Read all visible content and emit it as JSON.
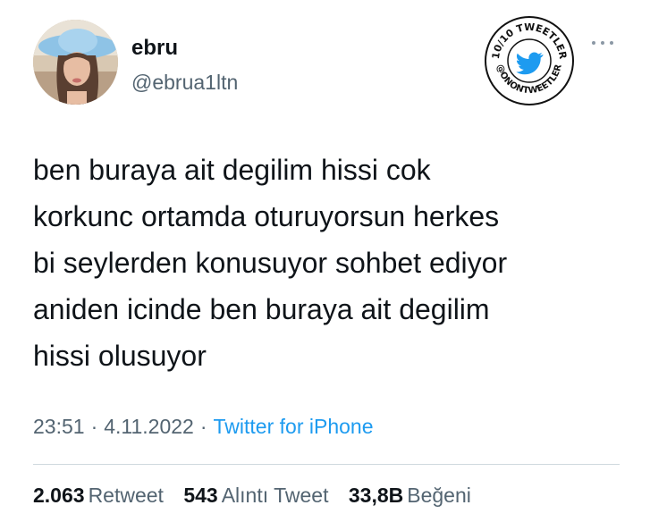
{
  "author": {
    "display_name": "ebru",
    "handle": "@ebrua1ltn"
  },
  "badge": {
    "top_text": "10/10 TWEETLER",
    "bottom_text": "@ONONTWEETLER",
    "icon": "twitter-bird-icon",
    "accent": "#1d9bf0"
  },
  "more_icon": "more-horizontal-icon",
  "tweet": {
    "lines": [
      "ben buraya ait degilim hissi cok",
      "korkunc ortamda oturuyorsun herkes",
      "bi seylerden konusuyor sohbet ediyor",
      "aniden icinde ben buraya ait degilim",
      "hissi olusuyor"
    ]
  },
  "meta": {
    "time": "23:51",
    "separator": "·",
    "date": "4.11.2022",
    "source": "Twitter for iPhone"
  },
  "stats": {
    "retweets": {
      "count": "2.063",
      "label": "Retweet"
    },
    "quotes": {
      "count": "543",
      "label": "Alıntı Tweet"
    },
    "likes": {
      "count": "33,8B",
      "label": "Beğeni"
    }
  },
  "colors": {
    "text": "#0f1419",
    "secondary": "#536471",
    "link": "#1d9bf0",
    "divider": "#cfd9de"
  }
}
